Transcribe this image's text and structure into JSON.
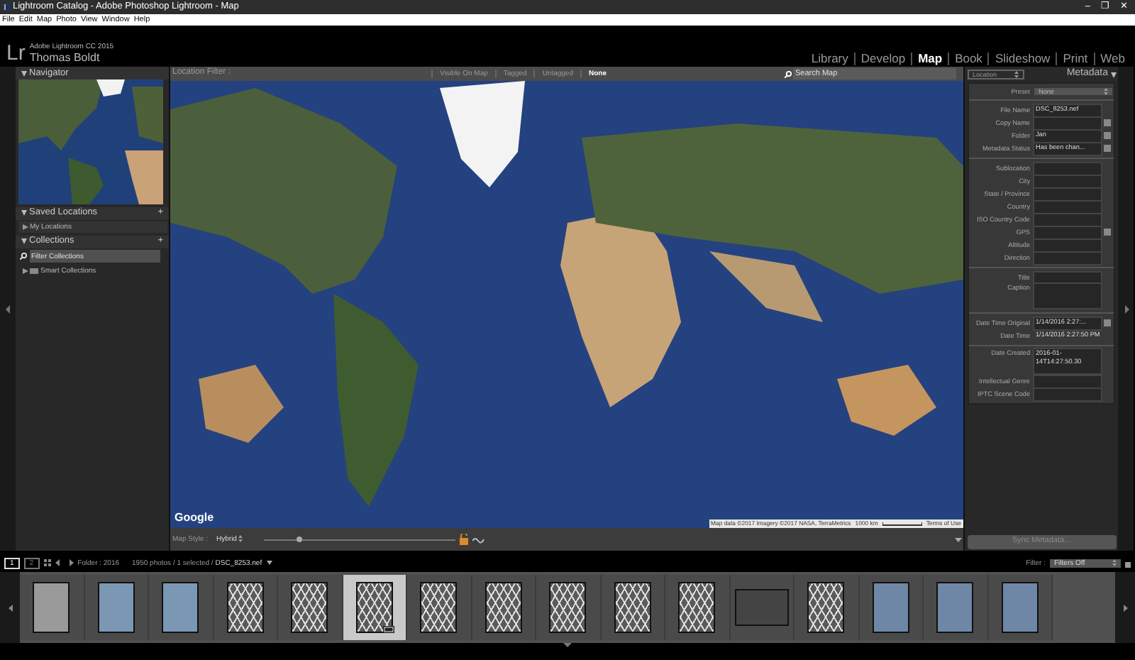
{
  "window": {
    "title": "Lightroom Catalog - Adobe Photoshop Lightroom - Map",
    "controls": [
      "–",
      "❐",
      "✕"
    ]
  },
  "menu": [
    "File",
    "Edit",
    "Map",
    "Photo",
    "View",
    "Window",
    "Help"
  ],
  "identity": {
    "logo": "Lr",
    "product": "Adobe Lightroom CC 2015",
    "user": "Thomas Boldt"
  },
  "modules": [
    {
      "label": "Library",
      "selected": false
    },
    {
      "label": "Develop",
      "selected": false
    },
    {
      "label": "Map",
      "selected": true
    },
    {
      "label": "Book",
      "selected": false
    },
    {
      "label": "Slideshow",
      "selected": false
    },
    {
      "label": "Print",
      "selected": false
    },
    {
      "label": "Web",
      "selected": false
    }
  ],
  "left_panel": {
    "navigator": {
      "title": "Navigator"
    },
    "saved_locations": {
      "title": "Saved Locations",
      "add": "+",
      "items": [
        {
          "label": "My Locations",
          "expanded": false
        }
      ]
    },
    "collections": {
      "title": "Collections",
      "add": "+",
      "filter": {
        "placeholder": "Filter Collections"
      },
      "items": [
        {
          "label": "Smart Collections",
          "expanded": false
        }
      ]
    }
  },
  "location_filter": {
    "label": "Location Filter :",
    "options": [
      {
        "label": "Visible On Map",
        "selected": false
      },
      {
        "label": "Tagged",
        "selected": false
      },
      {
        "label": "Untagged",
        "selected": false
      },
      {
        "label": "None",
        "selected": true
      }
    ],
    "search": {
      "placeholder": "Search Map"
    }
  },
  "map": {
    "logo": "Google",
    "attribution": "Map data ©2017 Imagery ©2017 NASA, TerraMetrics",
    "scale": "1000 km",
    "terms": "Terms of Use"
  },
  "map_toolbar": {
    "style_label": "Map Style :",
    "style_value": "Hybrid",
    "zoom": {
      "level": 0.17
    },
    "locked": false
  },
  "right_panel": {
    "preset_menu": "Location",
    "title": "Metadata",
    "preset": {
      "label": "Preset",
      "value": "None"
    },
    "groups": [
      [
        {
          "label": "File Name",
          "value": "DSC_8253.nef",
          "button": false
        },
        {
          "label": "Copy Name",
          "button": true
        },
        {
          "label": "Folder",
          "value": "Jan",
          "button": true
        },
        {
          "label": "Metadata Status",
          "value": "Has been chan...",
          "button": true
        }
      ],
      [
        {
          "label": "Sublocation",
          "button": false
        },
        {
          "label": "City",
          "button": false
        },
        {
          "label": "State / Province",
          "button": false
        },
        {
          "label": "Country",
          "button": false
        },
        {
          "label": "ISO Country Code",
          "button": false
        },
        {
          "label": "GPS",
          "button": true
        },
        {
          "label": "Altitude",
          "button": false
        },
        {
          "label": "Direction",
          "button": false
        }
      ],
      [
        {
          "label": "Title",
          "button": false
        },
        {
          "label": "Caption",
          "button": false,
          "tall": true
        }
      ],
      [
        {
          "label": "Date Time Original",
          "value": "1/14/2016 2:27:...",
          "button": true
        },
        {
          "label": "Date Time",
          "value": "1/14/2016 2:27:50 PM",
          "button": false,
          "boxed": false
        }
      ],
      [
        {
          "label": "Date Created",
          "value": "2016-01-14T14:27:50.30",
          "button": false,
          "tall": true
        },
        {
          "label": "Intellectual Genre",
          "button": false
        },
        {
          "label": "IPTC Scene Code",
          "button": false
        }
      ]
    ],
    "sync_button": "Sync Metadata..."
  },
  "filmstrip": {
    "pages": [
      {
        "label": "1",
        "selected": true
      },
      {
        "label": "2",
        "selected": false
      }
    ],
    "folder": "Folder : 2016",
    "count": "1950 photos / 1 selected /",
    "file": "DSC_8253.nef",
    "filter_label": "Filter :",
    "filter_value": "Filters Off",
    "thumbnails": [
      {
        "kind": "interior",
        "selected": false
      },
      {
        "kind": "coast",
        "selected": false
      },
      {
        "kind": "coast",
        "selected": false
      },
      {
        "kind": "lattice",
        "selected": false
      },
      {
        "kind": "lattice",
        "selected": false
      },
      {
        "kind": "lattice",
        "selected": true
      },
      {
        "kind": "lattice",
        "selected": false
      },
      {
        "kind": "lattice",
        "selected": false
      },
      {
        "kind": "lattice",
        "selected": false
      },
      {
        "kind": "lattice",
        "selected": false
      },
      {
        "kind": "lattice",
        "selected": false
      },
      {
        "kind": "wide",
        "selected": false
      },
      {
        "kind": "lattice",
        "selected": false
      },
      {
        "kind": "grass",
        "selected": false
      },
      {
        "kind": "grass",
        "selected": false
      },
      {
        "kind": "grass",
        "selected": false
      }
    ]
  }
}
